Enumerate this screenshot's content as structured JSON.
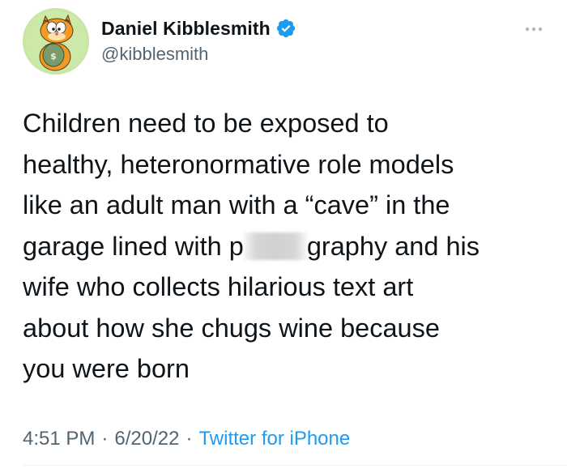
{
  "user": {
    "display_name": "Daniel Kibblesmith",
    "handle": "@kibblesmith",
    "verified_icon": "verified-badge-icon",
    "avatar_icon": "garfield-avatar"
  },
  "tweet": {
    "line1": "Children need to be exposed to",
    "line2": "healthy, heteronormative role models",
    "line3": "like an adult man with a “cave” in the",
    "line4_before": "garage lined with p",
    "line4_after": "graphy and his",
    "line5": "wife who collects hilarious text art",
    "line6": "about how she chugs wine because",
    "line7": "you were born"
  },
  "meta": {
    "time": "4:51 PM",
    "date": "6/20/22",
    "separator": "·",
    "source": "Twitter for iPhone"
  },
  "colors": {
    "text": "#0f1419",
    "secondary": "#536471",
    "accent": "#1d9bf0",
    "divider": "#eff3f4"
  }
}
